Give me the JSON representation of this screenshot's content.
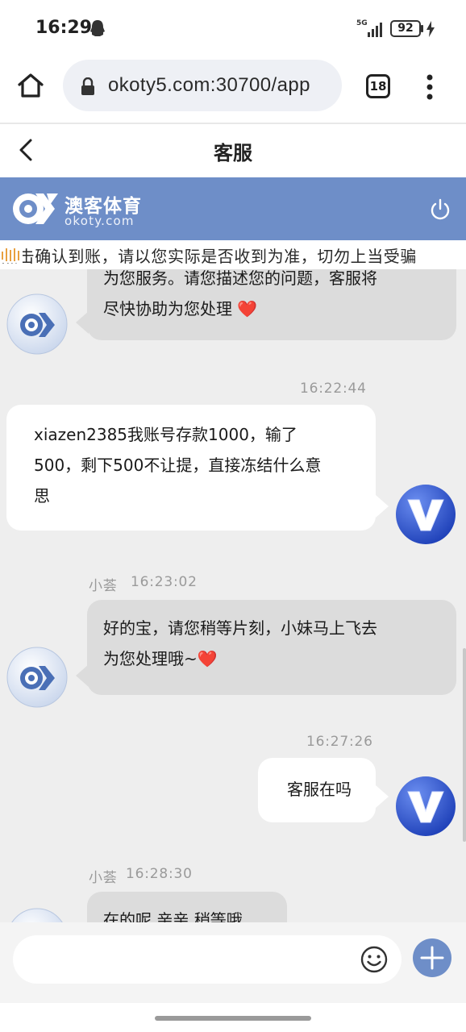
{
  "status_bar": {
    "time": "16:29",
    "network": "5G",
    "battery": "92"
  },
  "browser": {
    "url": "okoty5.com:30700/app",
    "tab_count": "18"
  },
  "header": {
    "title": "客服"
  },
  "brand": {
    "name": "澳客体育",
    "domain": "okoty.com"
  },
  "marquee": {
    "text": "点击确认到账，请以您实际是否收到为准，切勿上当受骗"
  },
  "colors": {
    "brand_blue": "#6e8ec8",
    "agent_bubble": "#dcdcdc",
    "user_bubble": "#ffffff"
  },
  "messages": [
    {
      "from": "agent",
      "lines": [
        "为您服务。请您描述您的问题，客服将",
        "尽快协助为您处理 ❤️"
      ]
    },
    {
      "from": "user",
      "time": "16:22:44",
      "lines": [
        "xiazen2385我账号存款1000，输了",
        "500，剩下500不让提，直接冻结什么意",
        "思"
      ]
    },
    {
      "from": "agent",
      "sender": "小荟",
      "time": "16:23:02",
      "lines": [
        "好的宝，请您稍等片刻，小妹马上飞去",
        "为您处理哦~❤️"
      ]
    },
    {
      "from": "user",
      "time": "16:27:26",
      "lines": [
        "客服在吗"
      ]
    },
    {
      "from": "agent",
      "sender": "小荟",
      "time": "16:28:30",
      "lines": [
        "在的呢 亲亲 稍等哦"
      ]
    }
  ],
  "input": {
    "placeholder": ""
  }
}
